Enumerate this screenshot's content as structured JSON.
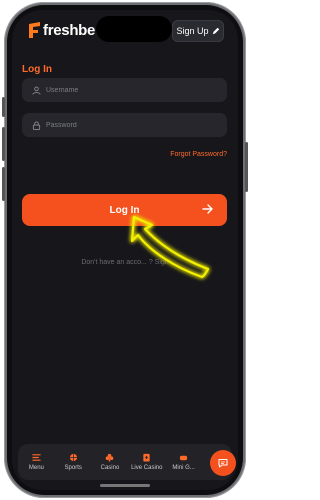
{
  "header": {
    "logo_text": "freshbe",
    "signup_label": "Sign Up"
  },
  "form": {
    "title": "Log In",
    "username_placeholder": "Username",
    "password_placeholder": "Password",
    "forgot_label": "Forgot Password?",
    "submit_label": "Log In",
    "no_account_text": "Don't have an acco... ? Sign"
  },
  "bottom_nav": {
    "items": [
      {
        "label": "Menu",
        "icon": "menu-icon"
      },
      {
        "label": "Sports",
        "icon": "ball-icon"
      },
      {
        "label": "Casino",
        "icon": "club-icon"
      },
      {
        "label": "Live Casino",
        "icon": "cards-icon"
      },
      {
        "label": "Mini G...",
        "icon": "game-icon"
      }
    ]
  },
  "colors": {
    "accent": "#f4511e",
    "background": "#17171b",
    "field": "#26262c",
    "highlight": "#f3f000"
  }
}
